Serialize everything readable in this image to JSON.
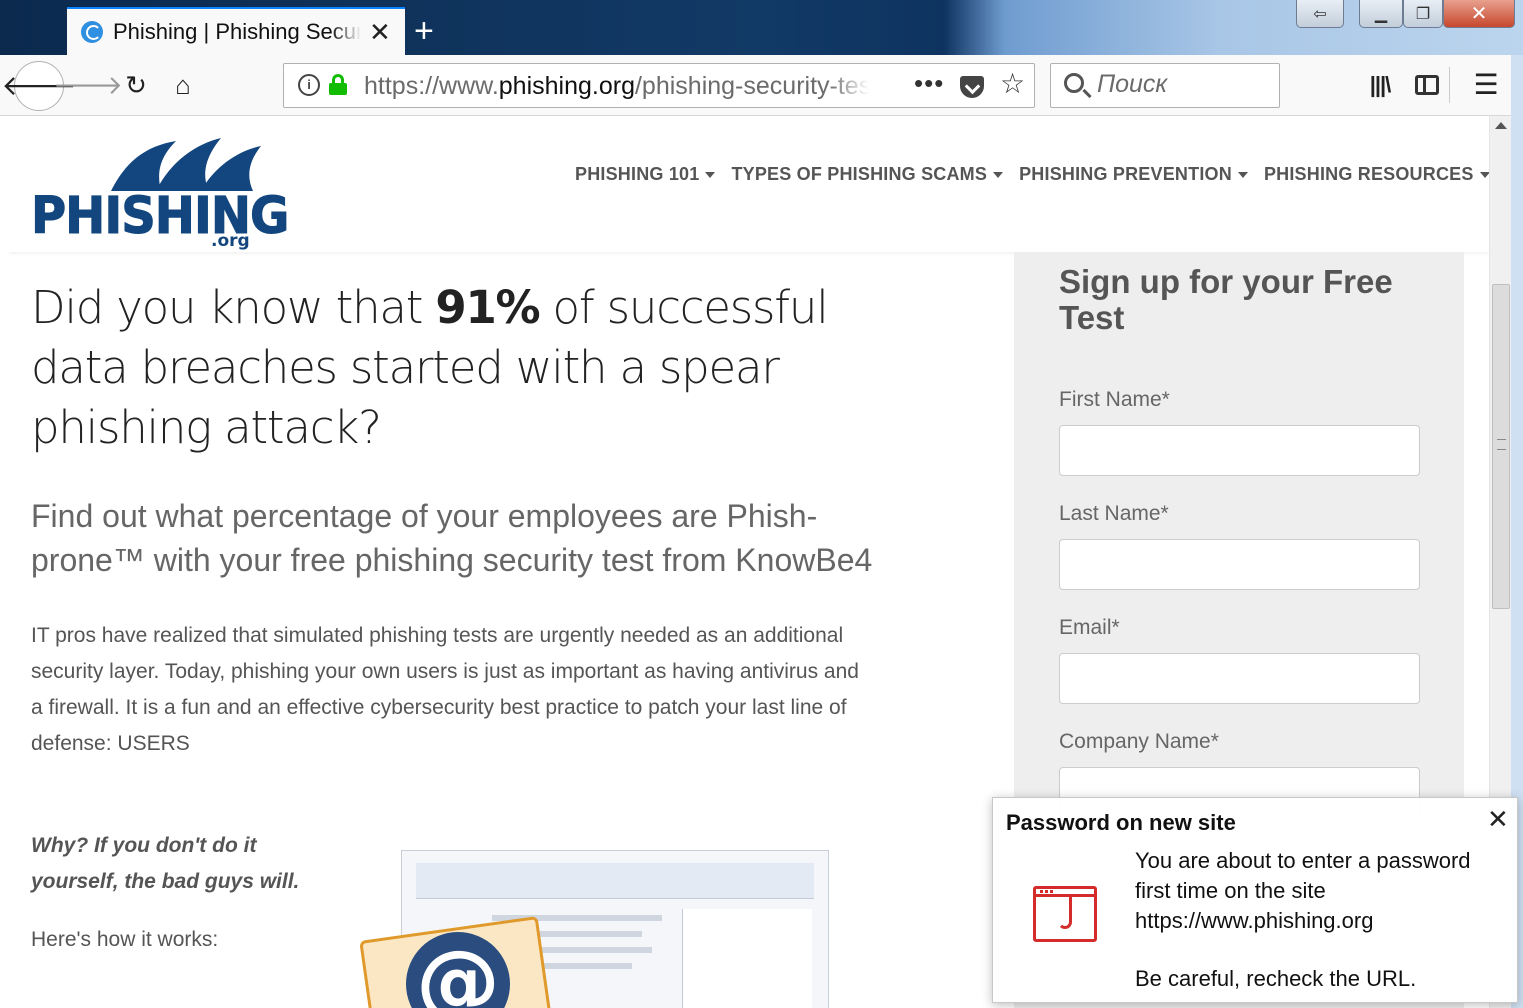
{
  "browser": {
    "tab_title": "Phishing | Phishing Security Test",
    "tab_close": "✕",
    "new_tab": "+",
    "window_buttons": {
      "restore_left": "⇦",
      "minimize": "▁",
      "maximize": "❐",
      "close": "✕"
    },
    "url_scheme": "https://www.",
    "url_domain": "phishing.org",
    "url_path": "/phishing-security-test",
    "search_placeholder": "Поиск",
    "icons": [
      "back-icon",
      "forward-icon",
      "reload-icon",
      "home-icon",
      "info-icon",
      "lock-icon",
      "page-actions-icon",
      "pocket-icon",
      "bookmark-star-icon",
      "search-icon",
      "library-icon",
      "sidebar-icon",
      "hamburger-menu-icon"
    ]
  },
  "site": {
    "logo_text": "PHISHING",
    "logo_sub": ".org",
    "nav": [
      {
        "label": "PHISHING 101"
      },
      {
        "label": "TYPES OF PHISHING SCAMS"
      },
      {
        "label": "PHISHING PREVENTION"
      },
      {
        "label": "PHISHING RESOURCES"
      }
    ]
  },
  "main": {
    "headline_pre": "Did you know that ",
    "headline_bold": "91%",
    "headline_post": " of successful data breaches started with a spear phishing attack?",
    "subhead": "Find out what percentage of your employees are Phish-prone™ with your free phishing security test from KnowBe4",
    "body": "IT pros have realized that simulated phishing tests are urgently needed as an additional security layer. Today, phishing your own users is just as important as having antivirus and a firewall. It is a fun and an effective cybersecurity best practice to patch your last line of defense: USERS",
    "why": "Why? If you don't do it yourself, the bad guys will.",
    "how": "Here's how it works:",
    "email_glyph": "@"
  },
  "form": {
    "title": "Sign up for your Free Test",
    "fields": [
      {
        "label": "First Name*"
      },
      {
        "label": "Last Name*"
      },
      {
        "label": "Email*"
      },
      {
        "label": "Company Name*"
      }
    ]
  },
  "popup": {
    "title": "Password on new site",
    "close": "✕",
    "message": "You are about to enter a password first time on the site https://www.phishing.org",
    "warning": "Be careful, recheck the URL."
  },
  "colors": {
    "brand": "#13467e",
    "accent": "#0a84ff",
    "secure": "#12bc00",
    "warning": "#d42b2b"
  }
}
